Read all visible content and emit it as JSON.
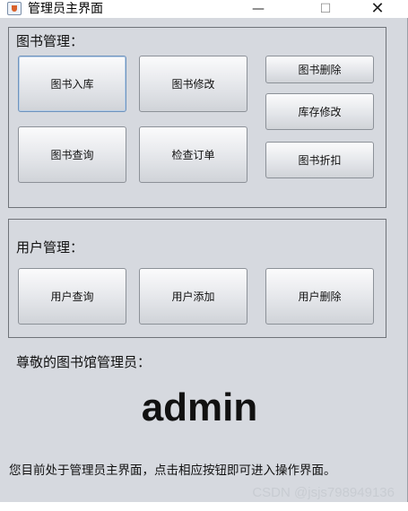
{
  "window": {
    "title": "管理员主界面",
    "controls": {
      "minimize": "—",
      "maximize": "☐",
      "close": "✕"
    }
  },
  "book_panel": {
    "title": "图书管理：",
    "buttons": {
      "add": "图书入库",
      "edit": "图书修改",
      "delete": "图书删除",
      "stock_edit": "库存修改",
      "query": "图书查询",
      "check_order": "检查订单",
      "discount": "图书折扣"
    }
  },
  "user_panel": {
    "title": "用户管理：",
    "buttons": {
      "query": "用户查询",
      "add": "用户添加",
      "delete": "用户删除"
    }
  },
  "greeting": "尊敬的图书馆管理员：",
  "username": "admin",
  "hint": "您目前处于管理员主界面，点击相应按钮即可进入操作界面。",
  "watermark": "CSDN @jsjs798949136"
}
